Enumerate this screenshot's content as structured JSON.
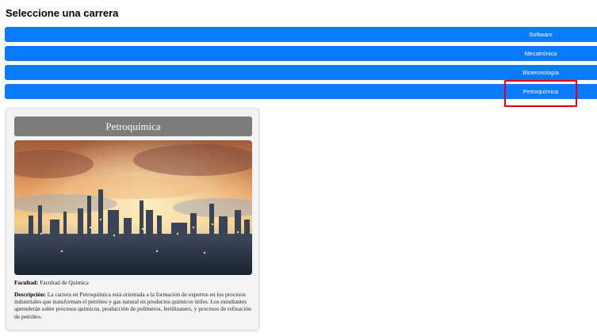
{
  "header": {
    "title": "Seleccione una carrera"
  },
  "careers": [
    {
      "label": "Software"
    },
    {
      "label": "Mecatrónica"
    },
    {
      "label": "Biotecnología"
    },
    {
      "label": "Petroquímica",
      "highlighted": true
    }
  ],
  "selected_card": {
    "title": "Petroquímica",
    "image_alt": "refinery",
    "faculty_label": "Facultad:",
    "faculty_value": "Facultad de Química",
    "description_label": "Descripción:",
    "description_value": "La carrera en Petroquímica está orientada a la formación de expertos en los procesos industriales que transforman el petróleo y gas natural en productos químicos útiles. Los estudiantes aprenderán sobre procesos químicos, producción de polímeros, fertilizantes, y procesos de refinación de petróleo."
  },
  "colors": {
    "button_bg": "#0a7aff",
    "card_title_bg": "#7c7c7c",
    "highlight": "#e8000b"
  }
}
